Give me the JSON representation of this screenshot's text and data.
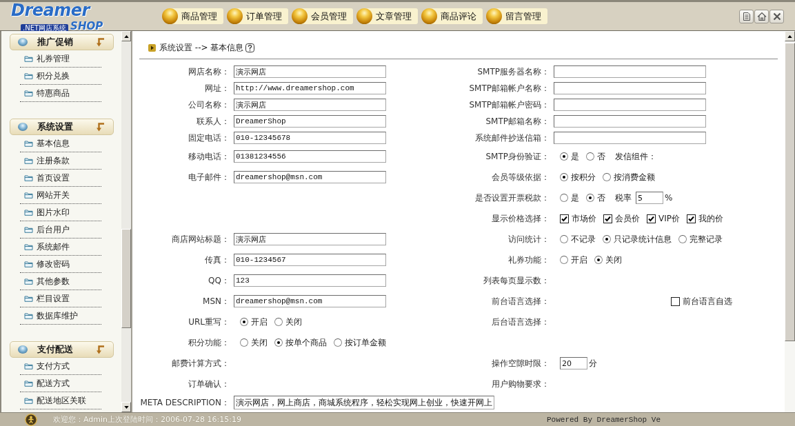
{
  "header": {
    "logo": {
      "wordmark": "Dreamer",
      "tagline": ".NET网店系统",
      "shop": "SHOP"
    },
    "nav": [
      "商品管理",
      "订单管理",
      "会员管理",
      "文章管理",
      "商品评论",
      "留言管理"
    ]
  },
  "sidebar": {
    "sections": [
      {
        "title": "推广促销",
        "items": [
          "礼券管理",
          "积分兑换",
          "特惠商品"
        ]
      },
      {
        "title": "系统设置",
        "items": [
          "基本信息",
          "注册条款",
          "首页设置",
          "网站开关",
          "图片水印",
          "后台用户",
          "系统邮件",
          "修改密码",
          "其他参数",
          "栏目设置",
          "数据库维护"
        ]
      },
      {
        "title": "支付配送",
        "items": [
          "支付方式",
          "配送方式",
          "配送地区关联"
        ]
      }
    ]
  },
  "breadcrumb": {
    "text": "系统设置 --> 基本信息"
  },
  "form": {
    "rows": [
      {
        "left": {
          "kind": "text",
          "label": "网店名称：",
          "value": "演示网店"
        },
        "right": {
          "kind": "text",
          "label": "SMTP服务器名称："
        }
      },
      {
        "left": {
          "kind": "text",
          "label": "网址：",
          "value": "http://www.dreamershop.com"
        },
        "right": {
          "kind": "text",
          "label": "SMTP邮箱帐户名称："
        }
      },
      {
        "left": {
          "kind": "text",
          "label": "公司名称：",
          "value": "演示网店"
        },
        "right": {
          "kind": "text",
          "label": "SMTP邮箱帐户密码："
        }
      },
      {
        "left": {
          "kind": "text",
          "label": "联系人：",
          "value": "DreamerShop"
        },
        "right": {
          "kind": "text",
          "label": "SMTP邮箱名称："
        }
      },
      {
        "left": {
          "kind": "text",
          "label": "固定电话：",
          "value": "010-12345678"
        },
        "right": {
          "kind": "text",
          "label": "系统邮件抄送信箱："
        }
      },
      {
        "left": {
          "kind": "text",
          "label": "移动电话：",
          "value": "01381234556"
        },
        "right": {
          "kind": "choices",
          "label": "SMTP身份验证：",
          "controls": [
            {
              "kind": "radio",
              "label": "是",
              "selected": true
            },
            {
              "kind": "radio",
              "label": "否",
              "selected": false
            },
            {
              "kind": "note",
              "text": "发信组件："
            }
          ]
        }
      },
      {
        "left": {
          "kind": "text",
          "label": "电子邮件：",
          "value": "dreamershop@msn.com"
        },
        "right": {
          "kind": "choices",
          "label": "会员等级依据：",
          "controls": [
            {
              "kind": "radio",
              "label": "按积分",
              "selected": true
            },
            {
              "kind": "radio",
              "label": "按消费金额",
              "selected": false
            }
          ]
        }
      },
      {
        "right": {
          "kind": "choices",
          "label": "是否设置开票税款：",
          "controls": [
            {
              "kind": "radio",
              "label": "是",
              "selected": false
            },
            {
              "kind": "radio",
              "label": "否",
              "selected": true
            },
            {
              "kind": "note",
              "text": "税率"
            },
            {
              "kind": "input",
              "value": "5"
            },
            {
              "kind": "unit",
              "text": "%"
            }
          ]
        }
      },
      {
        "right": {
          "kind": "choices",
          "label": "显示价格选择：",
          "controls": [
            {
              "kind": "checkbox",
              "label": "市场价",
              "checked": true
            },
            {
              "kind": "checkbox",
              "label": "会员价",
              "checked": true
            },
            {
              "kind": "checkbox",
              "label": "VIP价",
              "checked": true
            },
            {
              "kind": "checkbox",
              "label": "我的价",
              "checked": true
            }
          ]
        }
      },
      {
        "left": {
          "kind": "text",
          "label": "商店网站标题：",
          "value": "演示网店"
        },
        "right": {
          "kind": "choices",
          "label": "访问统计：",
          "controls": [
            {
              "kind": "radio",
              "label": "不记录",
              "selected": false
            },
            {
              "kind": "radio",
              "label": "只记录统计信息",
              "selected": true
            },
            {
              "kind": "radio",
              "label": "完整记录",
              "selected": false
            }
          ]
        }
      },
      {
        "left": {
          "kind": "text",
          "label": "传真：",
          "value": "010-1234567"
        },
        "right": {
          "kind": "choices",
          "label": "礼券功能：",
          "controls": [
            {
              "kind": "radio",
              "label": "开启",
              "selected": false
            },
            {
              "kind": "radio",
              "label": "关闭",
              "selected": true
            }
          ]
        }
      },
      {
        "left": {
          "kind": "text",
          "label": "QQ：",
          "value": "123"
        },
        "right": {
          "kind": "label",
          "label": "列表每页显示数："
        }
      },
      {
        "left": {
          "kind": "text",
          "label": "MSN：",
          "value": "dreamershop@msn.com"
        },
        "right": {
          "kind": "choices",
          "label": "前台语言选择：",
          "controls": [
            {
              "kind": "checkbox",
              "label": "前台语言自选",
              "checked": false
            }
          ]
        }
      },
      {
        "left": {
          "kind": "choices",
          "label": "URL重写：",
          "controls": [
            {
              "kind": "radio",
              "label": "开启",
              "selected": true
            },
            {
              "kind": "radio",
              "label": "关闭",
              "selected": false
            }
          ]
        },
        "right": {
          "kind": "label",
          "label": "后台语言选择："
        }
      },
      {
        "left": {
          "kind": "choices",
          "label": "积分功能：",
          "controls": [
            {
              "kind": "radio",
              "label": "关闭",
              "selected": false
            },
            {
              "kind": "radio",
              "label": "按单个商品",
              "selected": true
            },
            {
              "kind": "radio",
              "label": "按订单金额",
              "selected": false
            }
          ]
        }
      },
      {
        "left": {
          "kind": "label",
          "label": "邮费计算方式："
        },
        "right": {
          "kind": "choices",
          "label": "操作空隙时限：",
          "controls": [
            {
              "kind": "input",
              "value": "20"
            },
            {
              "kind": "unit",
              "text": "分"
            }
          ]
        }
      },
      {
        "left": {
          "kind": "label",
          "label": "订单确认："
        },
        "right": {
          "kind": "label",
          "label": "用户购物要求："
        }
      },
      {
        "left": {
          "kind": "textarea",
          "label": "META DESCRIPTION：",
          "value": "演示网店，网上商店，商城系统程序，轻松实现网上创业，快速开网上"
        }
      }
    ]
  },
  "status_bar": {
    "welcome": "欢迎您：Admin上次登陆时间：2006-07-28 16:15:19",
    "powered": "Powered By DreamerShop Ve"
  }
}
